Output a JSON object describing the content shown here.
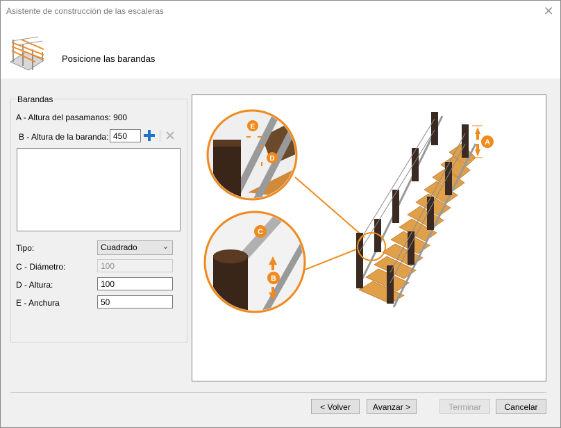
{
  "window": {
    "title": "Asistente de construcción de las escaleras",
    "close_glyph": "✕"
  },
  "header": {
    "title": "Posicione las barandas",
    "icon": "stair-wizard-icon"
  },
  "group": {
    "legend": "Barandas",
    "handrail_height_label": "A - Altura del pasamanos: 900",
    "railing_height_label": "B - Altura de la baranda:",
    "railing_height_value": "450",
    "add_icon": "plus-icon",
    "remove_icon": "close-icon",
    "list_items": []
  },
  "fields": {
    "type_label": "Tipo:",
    "type_value": "Cuadrado",
    "diameter_label": "C - Diámetro:",
    "diameter_value": "100",
    "height_label": "D - Altura:",
    "height_value": "100",
    "width_label": "E - Anchura",
    "width_value": "50"
  },
  "illustration": {
    "markers": [
      "A",
      "B",
      "C",
      "D",
      "E"
    ],
    "accent_color": "#f08a1c"
  },
  "buttons": {
    "back": "< Volver",
    "next": "Avanzar >",
    "finish": "Terminar",
    "cancel": "Cancelar"
  }
}
